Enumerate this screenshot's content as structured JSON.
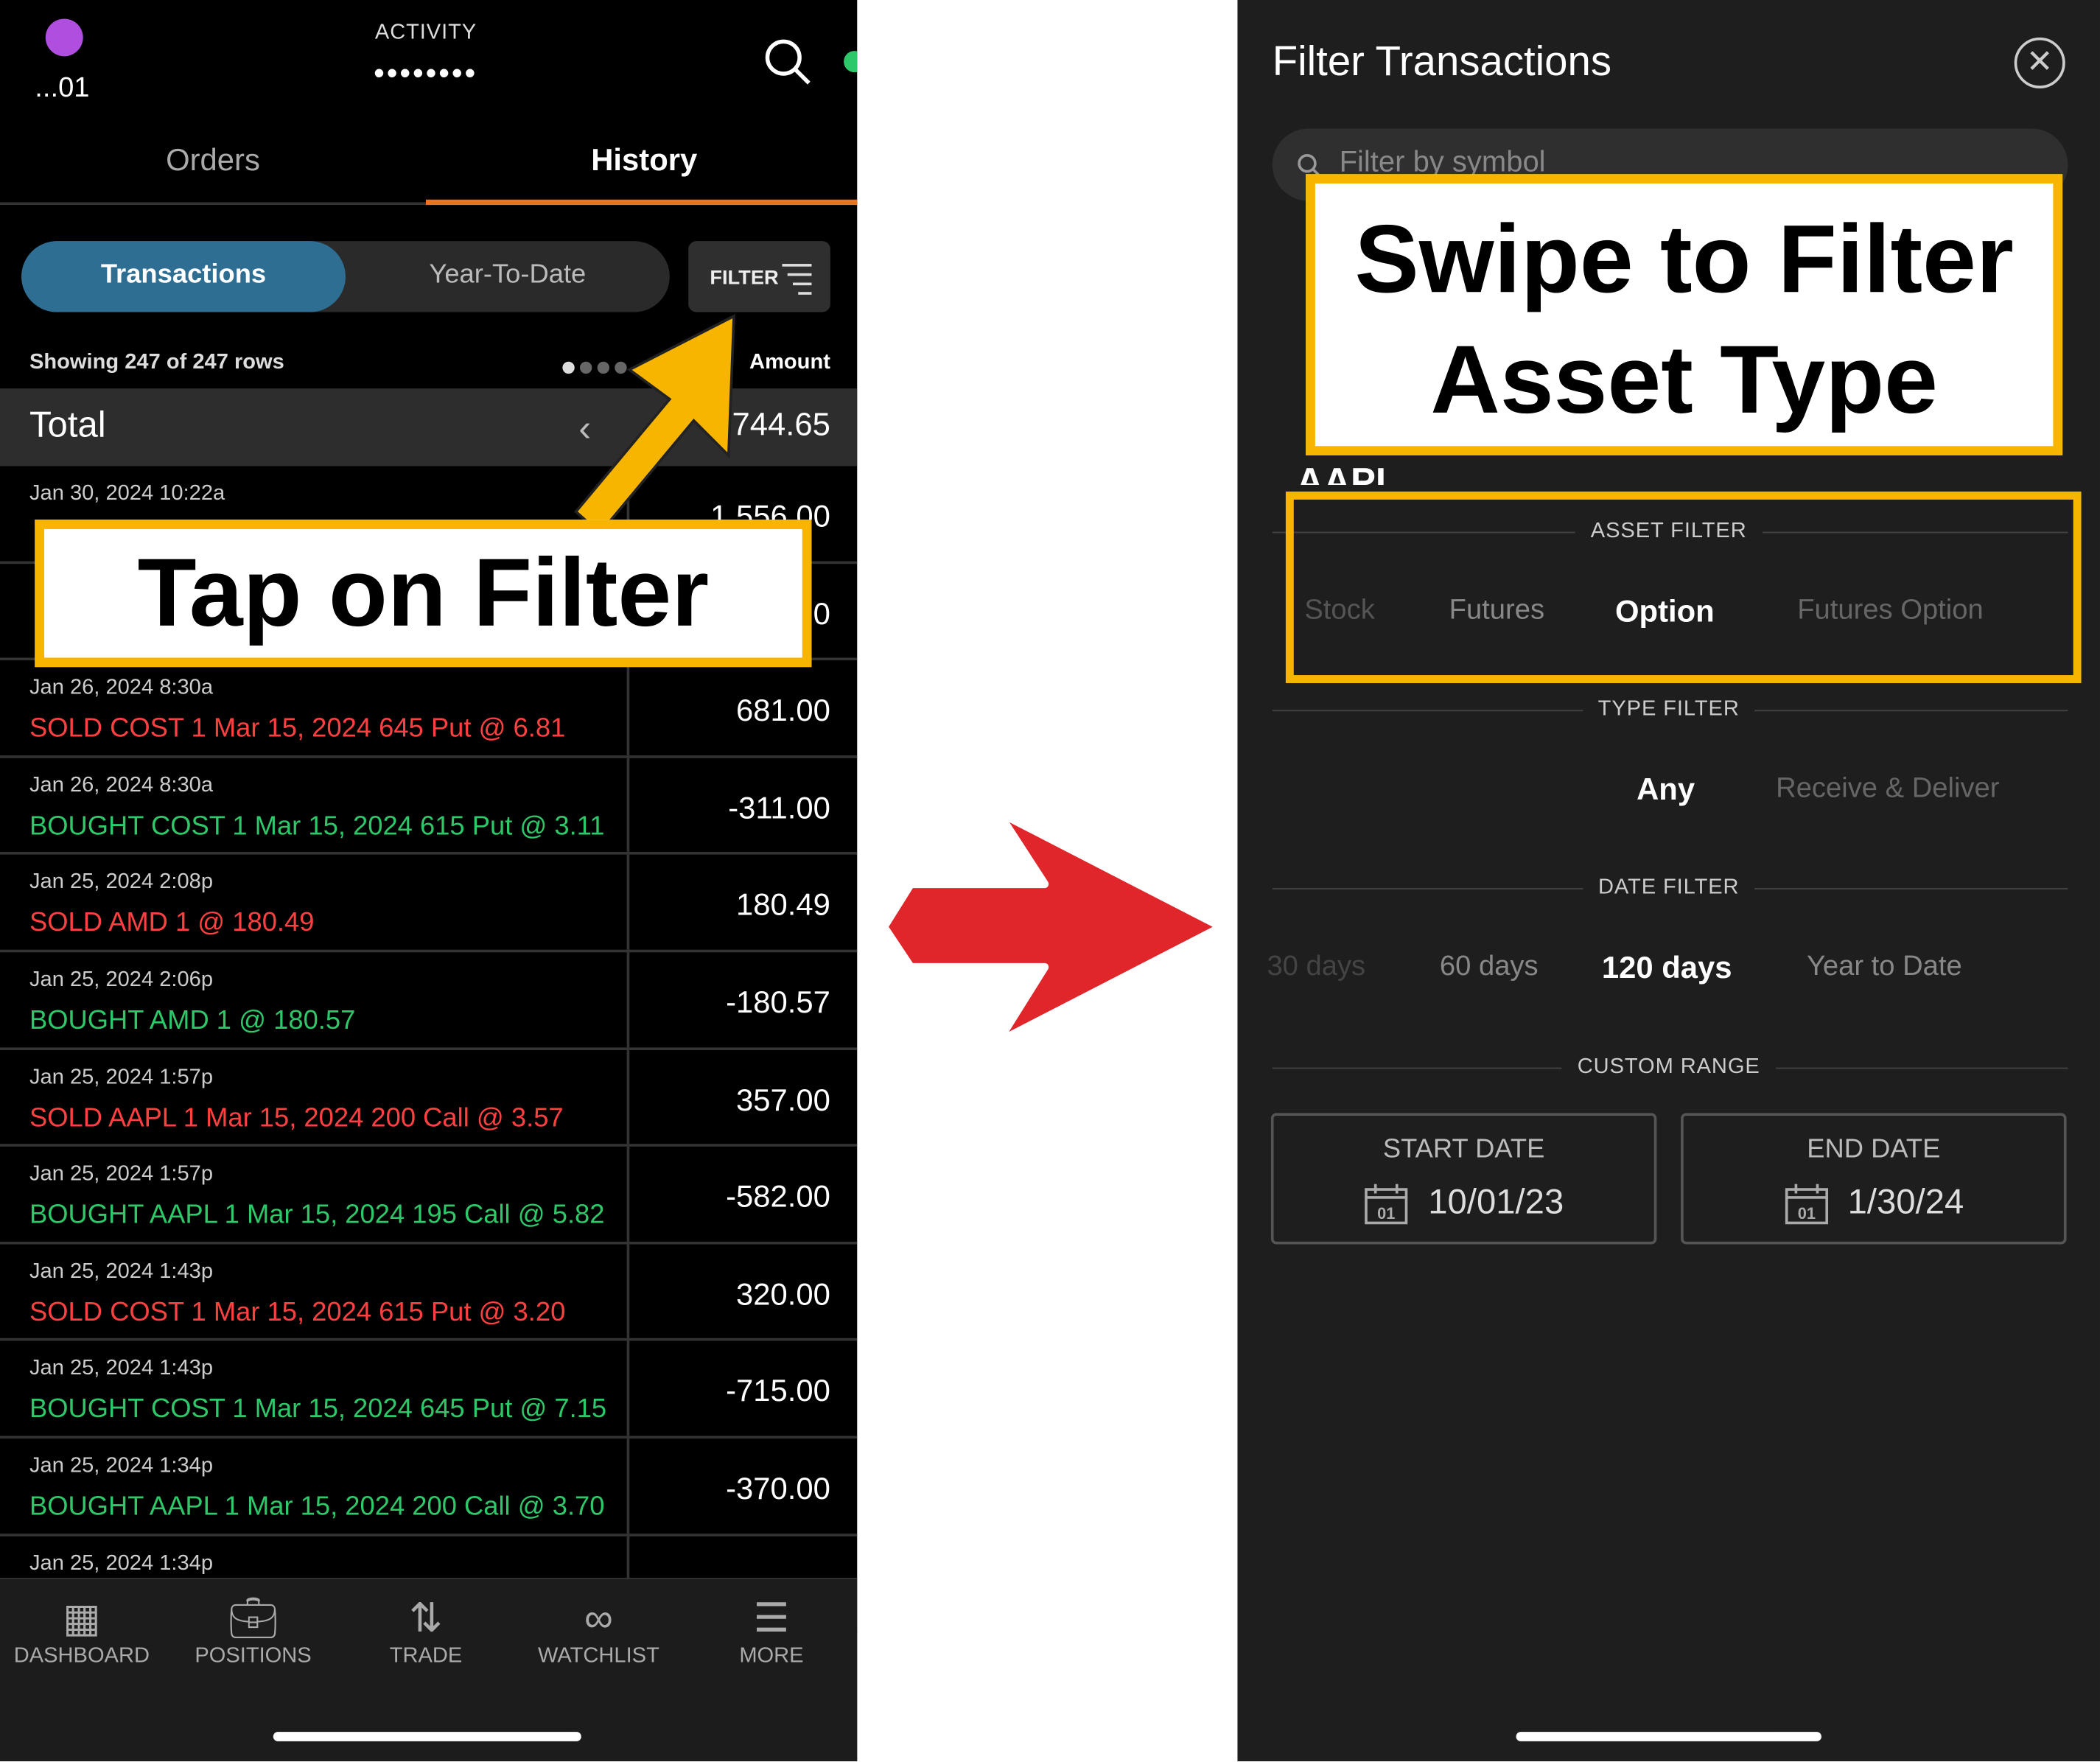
{
  "left_screen": {
    "account": "...01",
    "activity_label": "ACTIVITY",
    "activity_masked": "••••••••",
    "tabs": [
      {
        "label": "Orders"
      },
      {
        "label": "History"
      }
    ],
    "segments": {
      "transactions": "Transactions",
      "ytd": "Year-To-Date"
    },
    "filter_label": "FILTER",
    "showing_text": "Showing 247 of 247 rows",
    "amount_header": "Amount",
    "total_label": "Total",
    "total_amount": "-744.65",
    "rows": [
      {
        "date": "Jan 30, 2024  10:22a",
        "desc": "",
        "amount": "1,556.00",
        "color": "red"
      },
      {
        "date": "",
        "desc": "",
        "amount": "0",
        "color": "red"
      },
      {
        "date": "Jan 26, 2024  8:30a",
        "desc": "SOLD COST 1 Mar 15, 2024 645 Put @ 6.81",
        "amount": "681.00",
        "color": "red"
      },
      {
        "date": "Jan 26, 2024  8:30a",
        "desc": "BOUGHT COST 1 Mar 15, 2024 615 Put @ 3.11",
        "amount": "-311.00",
        "color": "green"
      },
      {
        "date": "Jan 25, 2024  2:08p",
        "desc": "SOLD AMD 1 @ 180.49",
        "amount": "180.49",
        "color": "red"
      },
      {
        "date": "Jan 25, 2024  2:06p",
        "desc": "BOUGHT AMD 1 @ 180.57",
        "amount": "-180.57",
        "color": "green"
      },
      {
        "date": "Jan 25, 2024  1:57p",
        "desc": "SOLD AAPL 1 Mar 15, 2024 200 Call @ 3.57",
        "amount": "357.00",
        "color": "red"
      },
      {
        "date": "Jan 25, 2024  1:57p",
        "desc": "BOUGHT AAPL 1 Mar 15, 2024 195 Call @ 5.82",
        "amount": "-582.00",
        "color": "green"
      },
      {
        "date": "Jan 25, 2024  1:43p",
        "desc": "SOLD COST 1 Mar 15, 2024 615 Put @ 3.20",
        "amount": "320.00",
        "color": "red"
      },
      {
        "date": "Jan 25, 2024  1:43p",
        "desc": "BOUGHT COST 1 Mar 15, 2024 645 Put @ 7.15",
        "amount": "-715.00",
        "color": "green"
      },
      {
        "date": "Jan 25, 2024  1:34p",
        "desc": "BOUGHT AAPL 1 Mar 15, 2024 200 Call @ 3.70",
        "amount": "-370.00",
        "color": "green"
      },
      {
        "date": "Jan 25, 2024  1:34p",
        "desc": "",
        "amount": "",
        "color": "green"
      }
    ],
    "nav": [
      "DASHBOARD",
      "POSITIONS",
      "TRADE",
      "WATCHLIST",
      "MORE"
    ]
  },
  "callouts": {
    "tap": "Tap on Filter",
    "swipe_line1": "Swipe to Filter",
    "swipe_line2": "Asset Type"
  },
  "right_screen": {
    "title": "Filter Transactions",
    "search_placeholder": "Filter by symbol",
    "peek_symbol": "AAPL",
    "asset_filter": {
      "label": "ASSET FILTER",
      "options": [
        "Stock",
        "Futures",
        "Option",
        "Futures Option"
      ],
      "selected": "Option"
    },
    "type_filter": {
      "label": "TYPE FILTER",
      "options": [
        "Any",
        "Receive & Deliver"
      ],
      "selected": "Any"
    },
    "date_filter": {
      "label": "DATE FILTER",
      "options": [
        "30 days",
        "60 days",
        "120 days",
        "Year to Date"
      ],
      "selected": "120 days"
    },
    "custom_range": {
      "label": "CUSTOM RANGE",
      "start_label": "START DATE",
      "start_value": "10/01/23",
      "end_label": "END DATE",
      "end_value": "1/30/24",
      "calendar_day": "01"
    }
  },
  "colors": {
    "accent_orange": "#e8741c",
    "segment_blue": "#2f6e93",
    "callout_yellow": "#f7b500",
    "arrow_red": "#e0262b",
    "sold_red": "#ff4040",
    "bought_green": "#2ec86a"
  }
}
